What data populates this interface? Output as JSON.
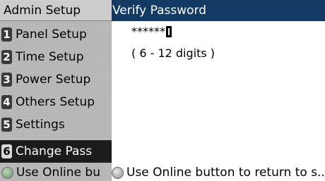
{
  "menu": {
    "header": "Admin Setup",
    "items": [
      {
        "number": "1",
        "label": "Panel Setup"
      },
      {
        "number": "2",
        "label": "Time Setup"
      },
      {
        "number": "3",
        "label": "Power Setup"
      },
      {
        "number": "4",
        "label": "Others Setup"
      },
      {
        "number": "5",
        "label": "Settings"
      },
      {
        "number": "6",
        "label": "Change Pass"
      }
    ],
    "selected_index": 5,
    "footer": "Use Online bu"
  },
  "dialog": {
    "title": "Verify Password",
    "password_value": "******",
    "hint": "( 6 - 12 digits )",
    "footer": "Use Online button to return to s..."
  },
  "colors": {
    "title_bar": "#123a62",
    "selected_item": "#1c1c1c"
  },
  "icons": {
    "online_button": "online-button-icon"
  }
}
